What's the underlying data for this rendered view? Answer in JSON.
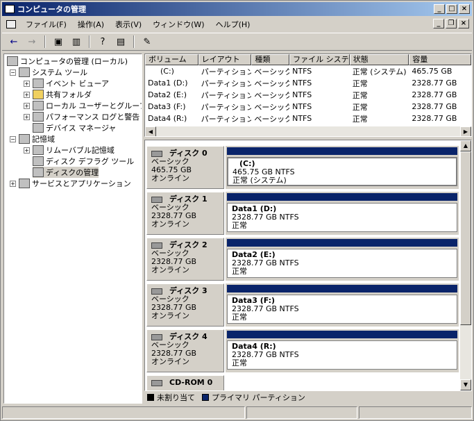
{
  "window": {
    "title": "コンピュータの管理",
    "min": "_",
    "max": "□",
    "close": "×"
  },
  "menu": [
    "ファイル(F)",
    "操作(A)",
    "表示(V)",
    "ウィンドウ(W)",
    "ヘルプ(H)"
  ],
  "mdi": {
    "min": "_",
    "restore": "❐",
    "close": "×"
  },
  "toolbar": [
    "←",
    "→",
    "▣",
    "▥",
    "?",
    "▤",
    "✎"
  ],
  "tree": {
    "root": "コンピュータの管理 (ローカル)",
    "system_tools": "システム ツール",
    "event_viewer": "イベント ビューア",
    "shared_folders": "共有フォルダ",
    "local_users": "ローカル ユーザーとグループ",
    "perf_logs": "パフォーマンス ログと警告",
    "device_manager": "デバイス マネージャ",
    "storage": "記憶域",
    "removable": "リムーバブル記憶域",
    "defrag": "ディスク デフラグ ツール",
    "disk_mgmt": "ディスクの管理",
    "services_apps": "サービスとアプリケーション"
  },
  "list": {
    "headers": [
      "ボリューム",
      "レイアウト",
      "種類",
      "ファイル システム",
      "状態",
      "容量"
    ],
    "rows": [
      [
        "(C:)",
        "パーティション",
        "ベーシック",
        "NTFS",
        "正常 (システム)",
        "465.75 GB"
      ],
      [
        "Data1 (D:)",
        "パーティション",
        "ベーシック",
        "NTFS",
        "正常",
        "2328.77 GB"
      ],
      [
        "Data2 (E:)",
        "パーティション",
        "ベーシック",
        "NTFS",
        "正常",
        "2328.77 GB"
      ],
      [
        "Data3 (F:)",
        "パーティション",
        "ベーシック",
        "NTFS",
        "正常",
        "2328.77 GB"
      ],
      [
        "Data4 (R:)",
        "パーティション",
        "ベーシック",
        "NTFS",
        "正常",
        "2328.77 GB"
      ]
    ]
  },
  "disks": [
    {
      "name": "ディスク 0",
      "type": "ベーシック",
      "size": "465.75 GB",
      "state": "オンライン",
      "vol": "(C:)",
      "vsize": "465.75 GB NTFS",
      "vstate": "正常 (システム)"
    },
    {
      "name": "ディスク 1",
      "type": "ベーシック",
      "size": "2328.77 GB",
      "state": "オンライン",
      "vol": "Data1  (D:)",
      "vsize": "2328.77 GB NTFS",
      "vstate": "正常"
    },
    {
      "name": "ディスク 2",
      "type": "ベーシック",
      "size": "2328.77 GB",
      "state": "オンライン",
      "vol": "Data2  (E:)",
      "vsize": "2328.77 GB NTFS",
      "vstate": "正常"
    },
    {
      "name": "ディスク 3",
      "type": "ベーシック",
      "size": "2328.77 GB",
      "state": "オンライン",
      "vol": "Data3  (F:)",
      "vsize": "2328.77 GB NTFS",
      "vstate": "正常"
    },
    {
      "name": "ディスク 4",
      "type": "ベーシック",
      "size": "2328.77 GB",
      "state": "オンライン",
      "vol": "Data4  (R:)",
      "vsize": "2328.77 GB NTFS",
      "vstate": "正常"
    }
  ],
  "cdrom": "CD-ROM 0",
  "legend": {
    "unalloc": "未割り当て",
    "primary": "プライマリ パーティション"
  },
  "colors": {
    "primary": "#0a246a",
    "unalloc": "#000000"
  }
}
